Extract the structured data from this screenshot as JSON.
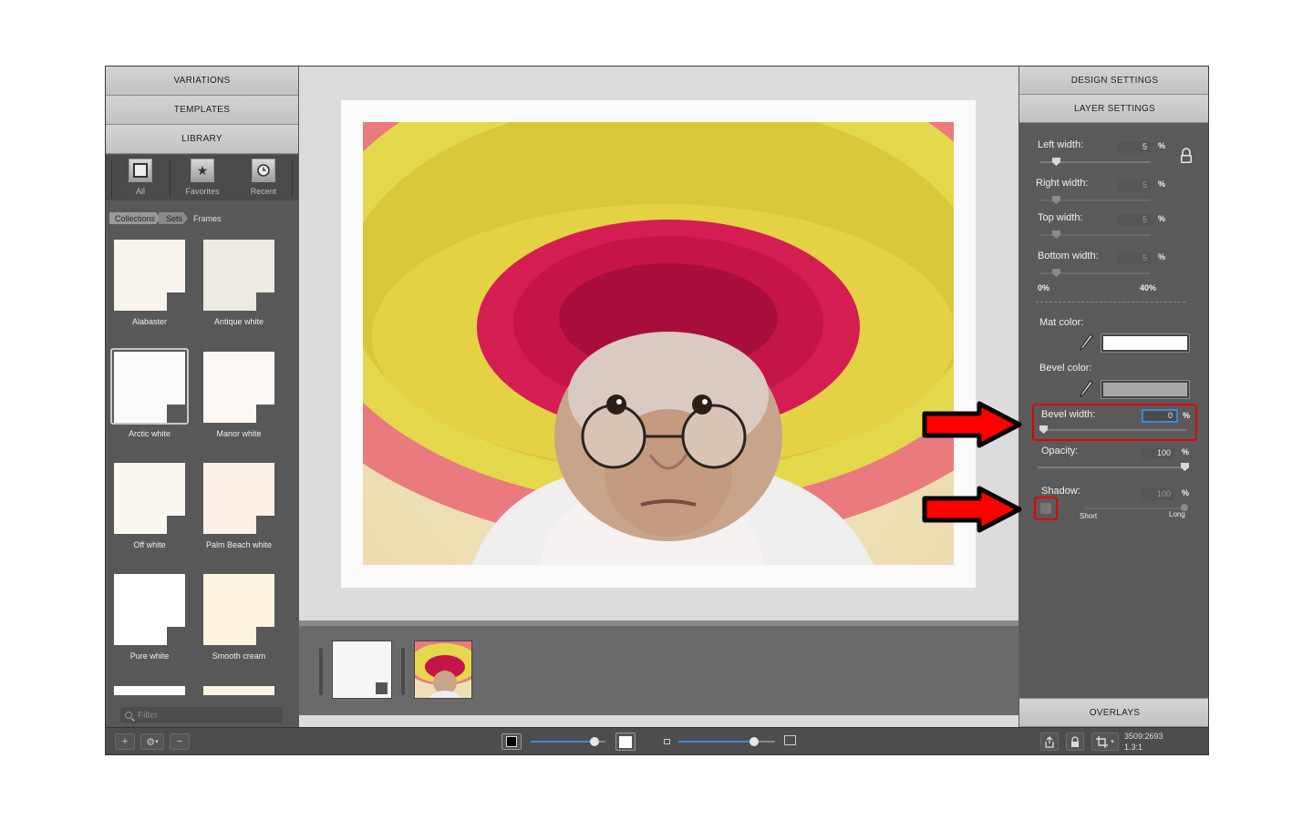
{
  "left": {
    "accordions": [
      "VARIATIONS",
      "TEMPLATES",
      "LIBRARY"
    ],
    "library_tabs": [
      {
        "label": "All",
        "icon": "square-frame-icon"
      },
      {
        "label": "Favorites",
        "icon": "star-icon"
      },
      {
        "label": "Recent",
        "icon": "clock-icon"
      }
    ],
    "breadcrumb": [
      "Collections",
      "Sets",
      "Frames"
    ],
    "swatches": [
      {
        "label": "Alabaster",
        "color": "#f8f3ec"
      },
      {
        "label": "Antique white",
        "color": "#edeae1"
      },
      {
        "label": "Arctic white",
        "color": "#fbfbfb"
      },
      {
        "label": "Manor white",
        "color": "#fdf8f3"
      },
      {
        "label": "Off white",
        "color": "#fbf8f0"
      },
      {
        "label": "Palm Beach white",
        "color": "#fdf0e6"
      },
      {
        "label": "Pure white",
        "color": "#ffffff"
      },
      {
        "label": "Smooth cream",
        "color": "#fdf4e2"
      }
    ],
    "selected_swatch": "Arctic white",
    "filter_placeholder": "Filter"
  },
  "right": {
    "design_settings": "DESIGN SETTINGS",
    "layer_settings": "LAYER SETTINGS",
    "left_width": {
      "label": "Left width:",
      "value": "5",
      "unit": "%"
    },
    "right_width": {
      "label": "Right width:",
      "value": "5",
      "unit": "%"
    },
    "top_width": {
      "label": "Top width:",
      "value": "5",
      "unit": "%"
    },
    "bottom_width": {
      "label": "Bottom width:",
      "value": "5",
      "unit": "%"
    },
    "range_min": "0%",
    "range_max": "40%",
    "mat_color": {
      "label": "Mat color:",
      "value": "#ffffff"
    },
    "bevel_color": {
      "label": "Bevel color:",
      "value": "#a8a8a8"
    },
    "bevel_width": {
      "label": "Bevel width:",
      "value": "0",
      "unit": "%"
    },
    "opacity": {
      "label": "Opacity:",
      "value": "100",
      "unit": "%"
    },
    "shadow": {
      "label": "Shadow:",
      "value": "100",
      "unit": "%",
      "min_label": "Short",
      "max_label": "Long",
      "enabled": false
    },
    "overlays": "OVERLAYS"
  },
  "toolbar": {
    "dimensions": "3509:2693",
    "ratio": "1.3:1",
    "thumb_zoom_level": 0.85,
    "canvas_zoom_level": 0.78
  },
  "colors": {
    "highlight": "#e00000",
    "arrow": "#ff0000",
    "accent": "#3a8ad8"
  }
}
